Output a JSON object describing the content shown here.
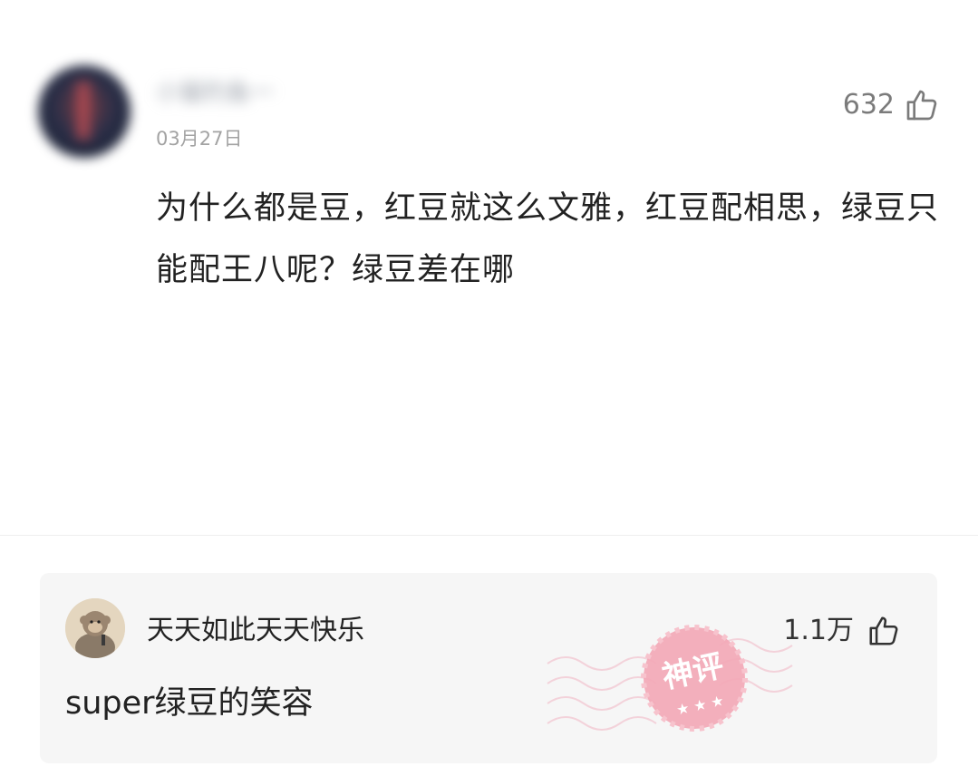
{
  "post": {
    "username": "小猫钓鱼一",
    "date": "03月27日",
    "likes": "632",
    "content": "为什么都是豆，红豆就这么文雅，红豆配相思，绿豆只能配王八呢？绿豆差在哪"
  },
  "hot_comment": {
    "username": "天天如此天天快乐",
    "likes": "1.1万",
    "text": "super绿豆的笑容",
    "badge": "神评"
  },
  "colors": {
    "badge_pink": "#f3a7b6",
    "text_primary": "#222222",
    "text_secondary": "#a3a3a3",
    "card_bg": "#f6f6f6"
  },
  "icons": {
    "like": "thumbs-up-icon"
  }
}
